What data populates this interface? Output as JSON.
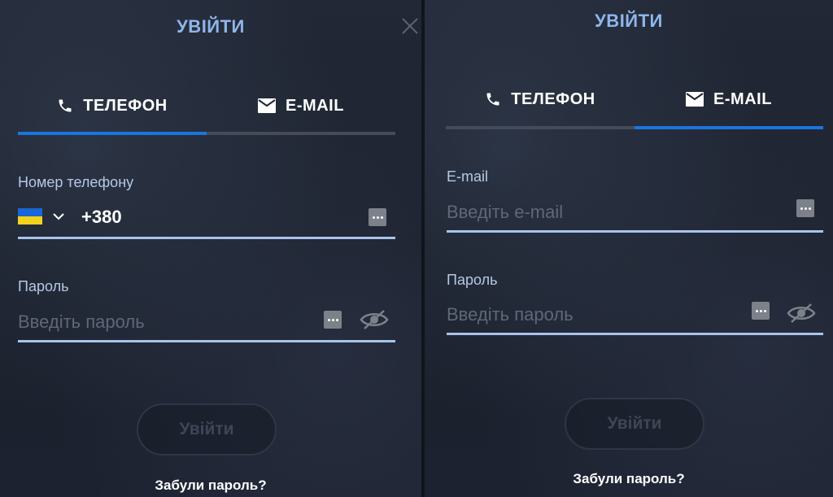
{
  "colors": {
    "accent": "#1a75e0",
    "title": "#8fb6ea",
    "field_line": "#a9c3ea",
    "ua_flag_blue": "#1a66d6",
    "ua_flag_yellow": "#f2d31b"
  },
  "left_panel": {
    "title": "УВІЙТИ",
    "close_icon": "close-icon",
    "tabs": [
      {
        "label": "ТЕЛЕФОН",
        "icon": "phone-icon",
        "active": true
      },
      {
        "label": "E-MAIL",
        "icon": "mail-icon",
        "active": false
      }
    ],
    "phone": {
      "label": "Номер телефону",
      "country_flag": "ukraine-flag",
      "prefix": "+380",
      "value": "",
      "placeholder": ""
    },
    "password": {
      "label": "Пароль",
      "value": "",
      "placeholder": "Введіть пароль"
    },
    "submit_label": "Увійти",
    "forgot_label": "Забули пароль?"
  },
  "right_panel": {
    "title": "УВІЙТИ",
    "tabs": [
      {
        "label": "ТЕЛЕФОН",
        "icon": "phone-icon",
        "active": false
      },
      {
        "label": "E-MAIL",
        "icon": "mail-icon",
        "active": true
      }
    ],
    "email": {
      "label": "E-mail",
      "value": "",
      "placeholder": "Введіть e-mail"
    },
    "password": {
      "label": "Пароль",
      "value": "",
      "placeholder": "Введіть пароль"
    },
    "submit_label": "Увійти",
    "forgot_label": "Забули пароль?"
  }
}
